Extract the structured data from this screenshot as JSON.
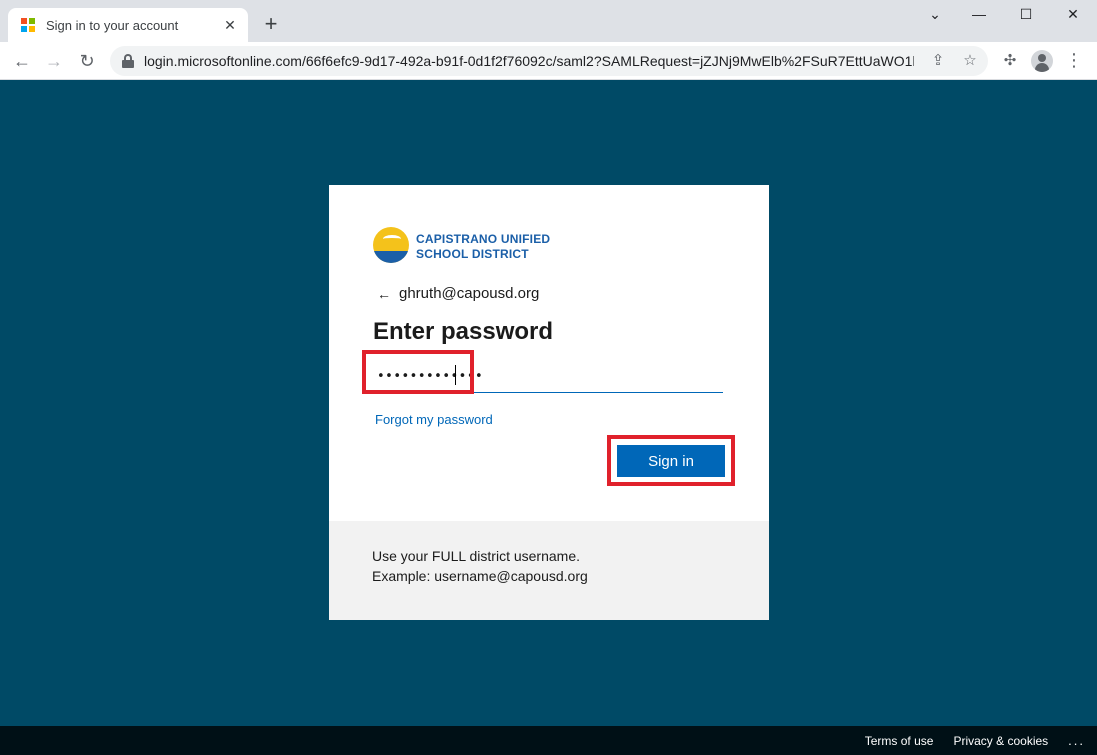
{
  "browser": {
    "tab_title": "Sign in to your account",
    "url": "login.microsoftonline.com/66f6efc9-9d17-492a-b91f-0d1f2f76092c/saml2?SAMLRequest=jZJNj9MwElb%2FSuR7EttUaWO1l..."
  },
  "card": {
    "org_name_line1": "CAPISTRANO UNIFIED",
    "org_name_line2": "SCHOOL DISTRICT",
    "username": "ghruth@capousd.org",
    "heading": "Enter password",
    "password_value": "•••••••••••••",
    "forgot_link": "Forgot my password",
    "signin_button": "Sign in"
  },
  "info_panel": {
    "line1": "Use your FULL district username.",
    "line2": "Example: username@capousd.org"
  },
  "footer": {
    "terms": "Terms of use",
    "privacy": "Privacy & cookies",
    "more": "..."
  },
  "colors": {
    "page_background": "#004a66",
    "accent": "#0067b8",
    "highlight": "#e0212b"
  }
}
